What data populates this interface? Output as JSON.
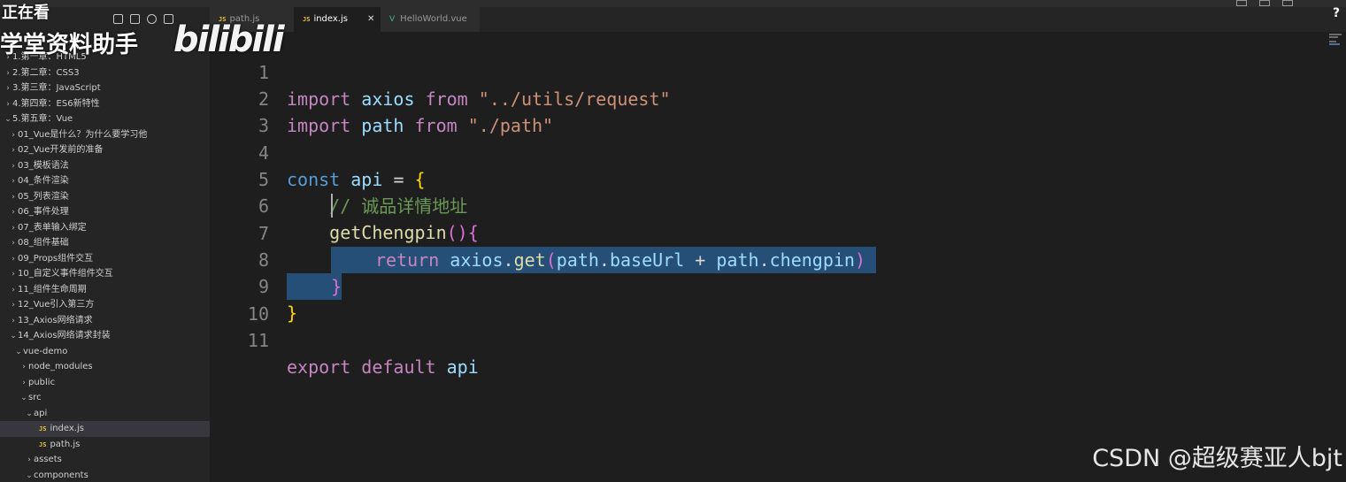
{
  "overlay": {
    "now_watching": "正在看",
    "brand": "学堂资料助手",
    "bili_logo": "bilibili"
  },
  "sidebar": {
    "title": "",
    "items": [
      {
        "label": "1.第一章：HTML5",
        "indent": 0,
        "chevron": "›"
      },
      {
        "label": "2.第二章：CSS3",
        "indent": 0,
        "chevron": "›"
      },
      {
        "label": "3.第三章：JavaScript",
        "indent": 0,
        "chevron": "›"
      },
      {
        "label": "4.第四章：ES6新特性",
        "indent": 0,
        "chevron": "›"
      },
      {
        "label": "5.第五章：Vue",
        "indent": 0,
        "chevron": "⌄"
      },
      {
        "label": "01_Vue是什么？为什么要学习他",
        "indent": 1,
        "chevron": "›"
      },
      {
        "label": "02_Vue开发前的准备",
        "indent": 1,
        "chevron": "›"
      },
      {
        "label": "03_模板语法",
        "indent": 1,
        "chevron": "›"
      },
      {
        "label": "04_条件渲染",
        "indent": 1,
        "chevron": "›"
      },
      {
        "label": "05_列表渲染",
        "indent": 1,
        "chevron": "›"
      },
      {
        "label": "06_事件处理",
        "indent": 1,
        "chevron": "›"
      },
      {
        "label": "07_表单输入绑定",
        "indent": 1,
        "chevron": "›"
      },
      {
        "label": "08_组件基础",
        "indent": 1,
        "chevron": "›"
      },
      {
        "label": "09_Props组件交互",
        "indent": 1,
        "chevron": "›"
      },
      {
        "label": "10_自定义事件组件交互",
        "indent": 1,
        "chevron": "›"
      },
      {
        "label": "11_组件生命周期",
        "indent": 1,
        "chevron": "›"
      },
      {
        "label": "12_Vue引入第三方",
        "indent": 1,
        "chevron": "›"
      },
      {
        "label": "13_Axios网络请求",
        "indent": 1,
        "chevron": "›"
      },
      {
        "label": "14_Axios网络请求封装",
        "indent": 1,
        "chevron": "⌄"
      },
      {
        "label": "vue-demo",
        "indent": 2,
        "chevron": "⌄"
      },
      {
        "label": "node_modules",
        "indent": 3,
        "chevron": "›"
      },
      {
        "label": "public",
        "indent": 3,
        "chevron": "›"
      },
      {
        "label": "src",
        "indent": 3,
        "chevron": "⌄"
      },
      {
        "label": "api",
        "indent": 4,
        "chevron": "⌄"
      },
      {
        "label": "index.js",
        "indent": 5,
        "chevron": "",
        "js": true,
        "selected": true
      },
      {
        "label": "path.js",
        "indent": 5,
        "chevron": "",
        "js": true
      },
      {
        "label": "assets",
        "indent": 4,
        "chevron": "›"
      },
      {
        "label": "components",
        "indent": 4,
        "chevron": "⌄"
      }
    ]
  },
  "tabs": [
    {
      "label": "path.js",
      "badge": "JS",
      "active": false
    },
    {
      "label": "index.js",
      "badge": "JS",
      "active": true,
      "close": "✕"
    },
    {
      "label": "HelloWorld.vue",
      "badge": "V",
      "active": false
    }
  ],
  "editor": {
    "line_numbers": [
      "1",
      "2",
      "3",
      "4",
      "5",
      "6",
      "7",
      "8",
      "9",
      "10",
      "11"
    ],
    "code": {
      "l1": {
        "kw1": "import",
        "var": "axios",
        "kw2": "from",
        "str": "\"../utils/request\""
      },
      "l2": {
        "kw1": "import",
        "var": "path",
        "kw2": "from",
        "str": "\"./path\""
      },
      "l4": {
        "kw": "const",
        "var": "api",
        "op": "=",
        "brace": "{"
      },
      "l5": {
        "comment": "// 诚品详情地址"
      },
      "l6": {
        "fn": "getChengpin",
        "parens": "()",
        "brace": "{"
      },
      "l7": {
        "kw": "return",
        "obj": "axios",
        "dot1": ".",
        "method": "get",
        "open": "(",
        "a1": "path",
        "dot2": ".",
        "p1": "baseUrl",
        "plus": "+",
        "a2": "path",
        "dot3": ".",
        "p2": "chengpin",
        "close": ")"
      },
      "l8": {
        "brace": "}"
      },
      "l9": {
        "brace": "}"
      },
      "l11": {
        "kw1": "export",
        "kw2": "default",
        "var": "api"
      }
    }
  },
  "help_icon": "?",
  "watermark": "CSDN @超级赛亚人bjt",
  "colors": {
    "editor_bg": "#1e1e1e",
    "sidebar_bg": "#252526",
    "keyword": "#c586c0",
    "variable": "#9cdcfe",
    "function": "#dcdcaa",
    "string": "#ce9178",
    "comment": "#6a9955",
    "selection": "#264f78"
  }
}
